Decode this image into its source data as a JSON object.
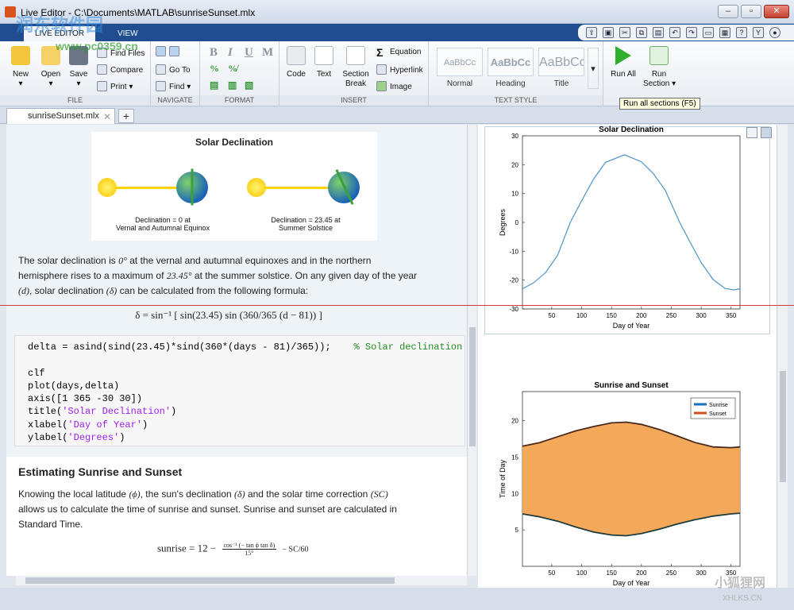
{
  "window": {
    "title": "Live Editor - C:\\Documents\\MATLAB\\sunriseSunset.mlx"
  },
  "ribbon_tabs": [
    "LIVE EDITOR",
    "VIEW"
  ],
  "ribbon": {
    "file": {
      "label": "FILE",
      "new": "New",
      "open": "Open",
      "save": "Save",
      "find_files": "Find Files",
      "compare": "Compare",
      "print": "Print"
    },
    "navigate": {
      "label": "NAVIGATE",
      "go_to": "Go To",
      "find": "Find"
    },
    "format": {
      "label": "FORMAT"
    },
    "insert": {
      "label": "INSERT",
      "code": "Code",
      "text": "Text",
      "section_break": "Section\nBreak",
      "equation": "Equation",
      "hyperlink": "Hyperlink",
      "image": "Image"
    },
    "text_style": {
      "label": "TEXT STYLE",
      "normal": "Normal",
      "heading": "Heading",
      "title": "Title",
      "preview": "AaBbCc"
    },
    "run": {
      "run_all": "Run All",
      "run_section": "Run\nSection"
    }
  },
  "tooltip": "Run all sections (F5)",
  "file_tab": {
    "name": "sunriseSunset.mlx"
  },
  "doc": {
    "image_title": "Solar Declination",
    "cap_left": "Declination = 0 at\nVernal and Autumnal Equinox",
    "cap_right": "Declination = 23.45 at\nSummer Solstice",
    "para1_a": "The solar declination is",
    "para1_b": "at the vernal and autumnal equinoxes and in the northern",
    "para1_c": "hemisphere rises to a maximum of",
    "para1_d": "at the summer solstice. On any given day of the year",
    "para1_e": ", solar declination",
    "para1_f": "can be calculated from the following formula:",
    "m_zero": "0°",
    "m_max": "23.45°",
    "m_d": "(d)",
    "m_delta": "(δ)",
    "formula1": "δ = sin⁻¹ [ sin(23.45) sin (360/365 (d − 81)) ]",
    "code_lines": [
      "delta = asind(sind(23.45)*sind(360*(days - 81)/365));",
      "",
      "clf",
      "plot(days,delta)",
      "axis([1 365 -30 30])",
      "title(",
      "xlabel(",
      "ylabel("
    ],
    "code_comment": "% Solar declination",
    "code_strings": [
      "'Solar Declination'",
      "'Day of Year'",
      "'Degrees'"
    ],
    "heading2": "Estimating Sunrise and Sunset",
    "para2_a": "Knowing the local latitude",
    "para2_b": ", the sun's declination",
    "para2_c": "and the solar time correction",
    "para2_d": "allows us to calculate the time of sunrise and sunset. Sunrise and sunset are calculated in",
    "para2_e": "Standard Time.",
    "m_phi": "(ϕ)",
    "m_sc": "(SC)",
    "formula2_lhs": "sunrise = 12 −",
    "formula2_num": "cos⁻¹ (− tan ϕ tan δ)",
    "formula2_den": "15°",
    "formula2_tail": "− SC/60"
  },
  "chart_data": [
    {
      "type": "line",
      "title": "Solar Declination",
      "xlabel": "Day of Year",
      "ylabel": "Degrees",
      "xlim": [
        1,
        365
      ],
      "ylim": [
        -30,
        30
      ],
      "xticks": [
        50,
        100,
        150,
        200,
        250,
        300,
        350
      ],
      "yticks": [
        -30,
        -20,
        -10,
        0,
        10,
        20,
        30
      ],
      "x": [
        1,
        20,
        40,
        60,
        81,
        100,
        120,
        140,
        172,
        200,
        220,
        240,
        264,
        280,
        300,
        320,
        340,
        355,
        365
      ],
      "y": [
        -23.0,
        -20.9,
        -17.3,
        -11.3,
        0,
        7.5,
        15.0,
        20.8,
        23.45,
        21.0,
        16.9,
        11.1,
        0,
        -6.3,
        -13.9,
        -19.8,
        -22.9,
        -23.4,
        -23.0
      ],
      "color": "#4e95c8"
    },
    {
      "type": "area",
      "title": "Sunrise and Sunset",
      "xlabel": "Day of Year",
      "ylabel": "Time of Day",
      "xlim": [
        1,
        365
      ],
      "ylim": [
        0,
        24
      ],
      "xticks": [
        50,
        100,
        150,
        200,
        250,
        300,
        350
      ],
      "yticks": [
        5,
        10,
        15,
        20
      ],
      "legend": {
        "placement": "top-right",
        "entries": [
          "Sunrise",
          "Sunset"
        ]
      },
      "x": [
        1,
        30,
        60,
        90,
        120,
        150,
        175,
        200,
        230,
        260,
        290,
        320,
        350,
        365
      ],
      "series": [
        {
          "name": "Sunrise",
          "values": [
            7.2,
            6.8,
            6.2,
            5.4,
            4.7,
            4.3,
            4.2,
            4.5,
            5.1,
            5.8,
            6.4,
            6.9,
            7.2,
            7.3
          ],
          "color": "#1d6fb8"
        },
        {
          "name": "Sunset",
          "values": [
            16.5,
            17.0,
            17.8,
            18.6,
            19.2,
            19.7,
            19.8,
            19.5,
            18.8,
            17.9,
            17.0,
            16.4,
            16.3,
            16.4
          ],
          "color": "#c8511e"
        }
      ],
      "fill_color": "#f4a95a"
    }
  ],
  "watermark": {
    "site_a": "润东软件园",
    "site_b": "www.pc0359.cn",
    "site_c": "小狐狸网",
    "site_d": "XHLKS.CN"
  }
}
